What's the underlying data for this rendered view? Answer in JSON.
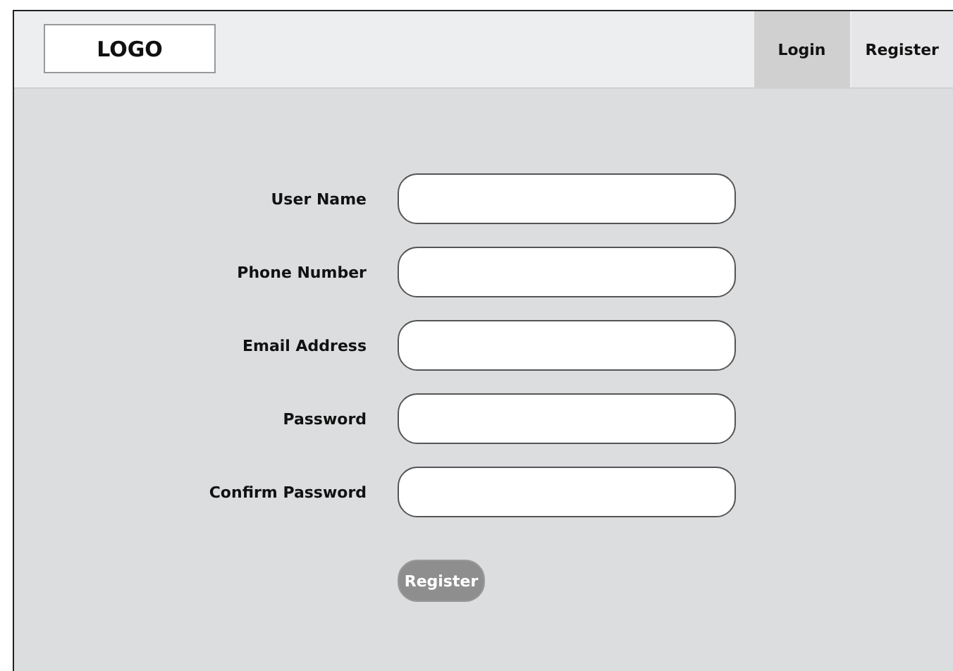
{
  "header": {
    "logo": "LOGO",
    "nav": [
      {
        "label": "Login",
        "selected": true
      },
      {
        "label": "Register",
        "selected": false
      }
    ]
  },
  "form": {
    "fields": [
      {
        "label": "User Name"
      },
      {
        "label": "Phone Number"
      },
      {
        "label": "Email Address"
      },
      {
        "label": "Password"
      },
      {
        "label": "Confirm Password"
      }
    ],
    "submit": "Register"
  }
}
